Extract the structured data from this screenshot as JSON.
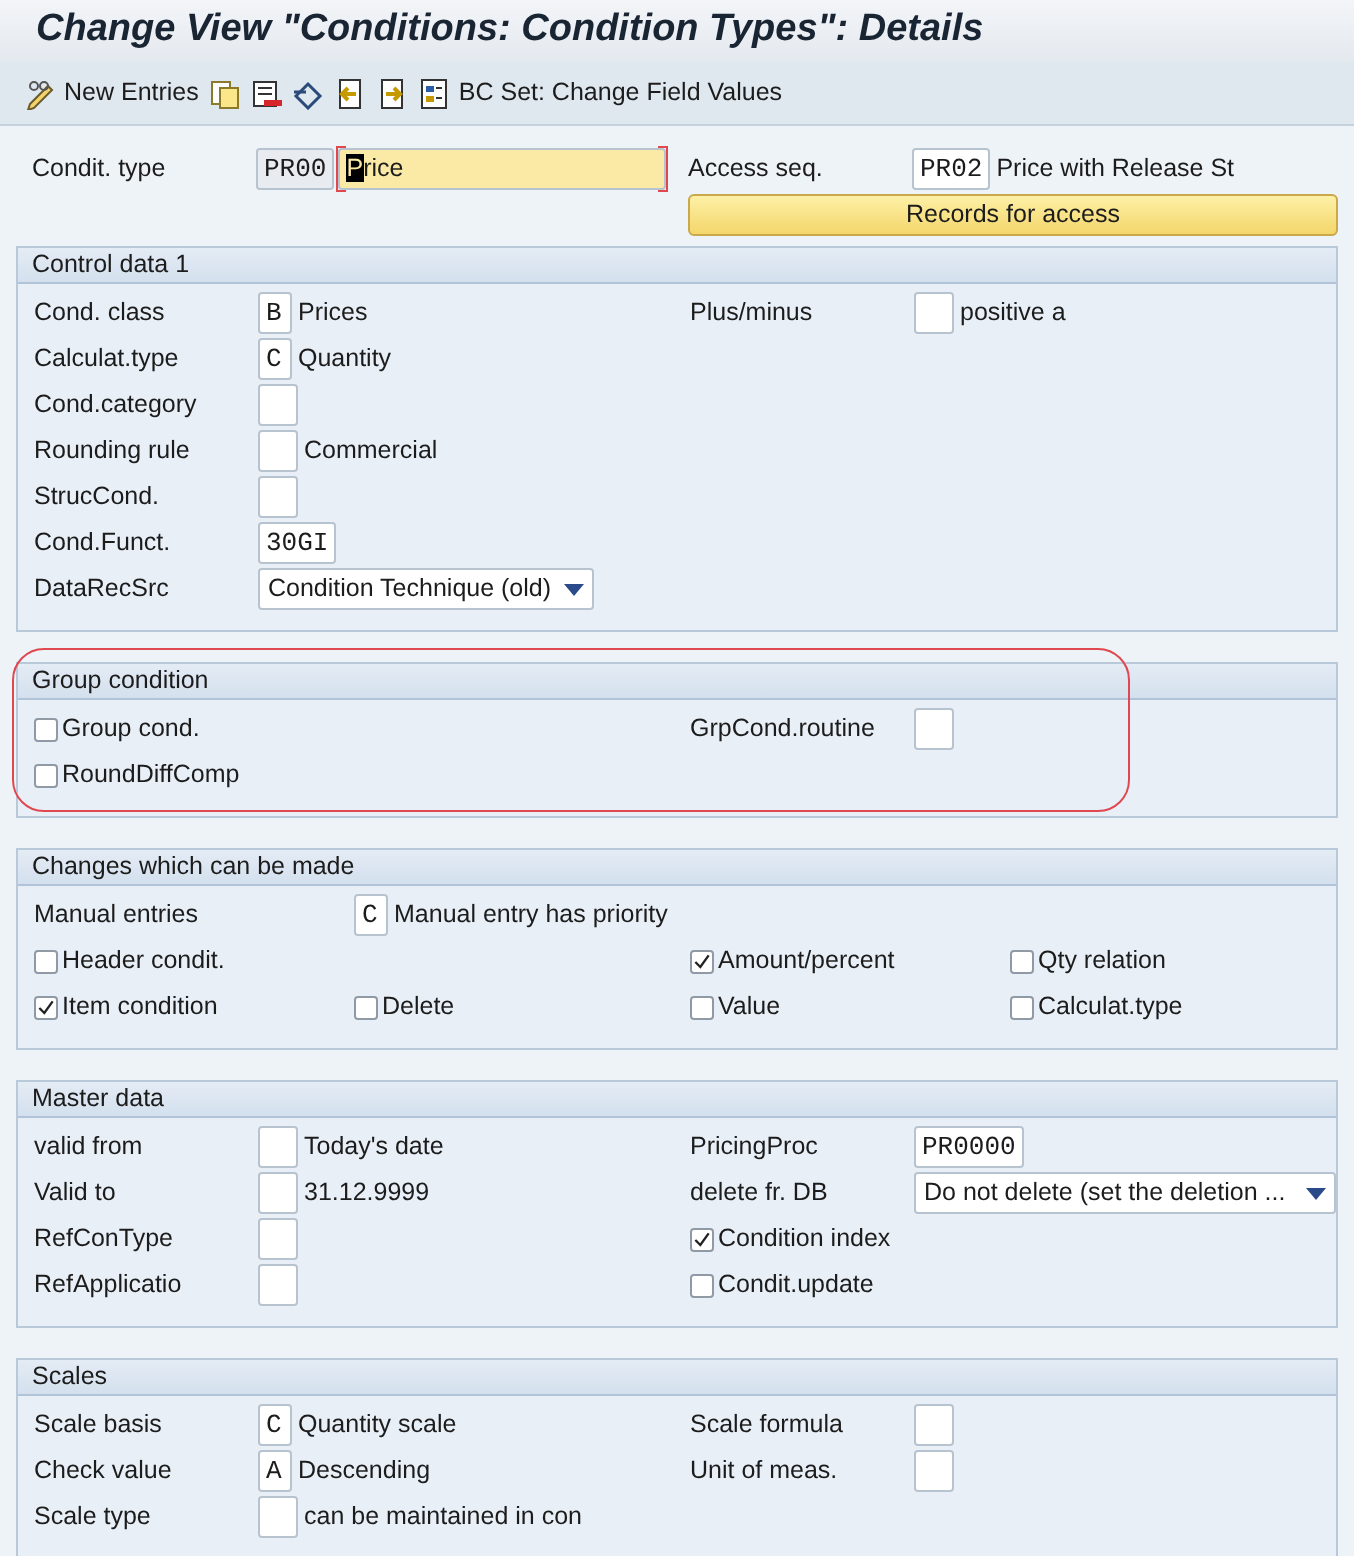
{
  "window": {
    "title": "Change View \"Conditions: Condition Types\": Details"
  },
  "toolbar": [
    "New Entries",
    "BC Set: Change Field Values"
  ],
  "header": {
    "rows": [
      {
        "left": [
          {
            "kind": "label",
            "text": "Condit. type"
          },
          {
            "kind": "field",
            "value": "PR00",
            "readonly": true
          },
          {
            "kind": "field",
            "value": "Price",
            "focused": true
          }
        ],
        "right": [
          {
            "kind": "label",
            "text": "Access seq."
          },
          {
            "kind": "field",
            "value": "PR02"
          },
          {
            "kind": "text",
            "text": "Price with Release St"
          }
        ]
      },
      {
        "left": [],
        "right": [
          {
            "kind": "button",
            "text": "Records for access"
          }
        ]
      }
    ]
  },
  "sections": [
    {
      "title": "Control data 1",
      "highlighted": false,
      "rows": [
        {
          "left": [
            {
              "kind": "label",
              "text": "Cond. class"
            },
            {
              "kind": "field",
              "value": "B"
            },
            {
              "kind": "text",
              "text": "Prices"
            }
          ],
          "right": [
            {
              "kind": "label",
              "text": "Plus/minus"
            },
            {
              "kind": "field"
            },
            {
              "kind": "text",
              "text": "positive a"
            }
          ]
        },
        {
          "left": [
            {
              "kind": "label",
              "text": "Calculat.type"
            },
            {
              "kind": "field",
              "value": "C"
            },
            {
              "kind": "text",
              "text": "Quantity"
            }
          ],
          "right": []
        },
        {
          "left": [
            {
              "kind": "label",
              "text": "Cond.category"
            },
            {
              "kind": "field"
            }
          ],
          "right": []
        },
        {
          "left": [
            {
              "kind": "label",
              "text": "Rounding rule"
            },
            {
              "kind": "field"
            },
            {
              "kind": "text",
              "text": "Commercial"
            }
          ],
          "right": []
        },
        {
          "left": [
            {
              "kind": "label",
              "text": "StrucCond."
            },
            {
              "kind": "field"
            }
          ],
          "right": []
        },
        {
          "left": [
            {
              "kind": "label",
              "text": "Cond.Funct."
            },
            {
              "kind": "field",
              "value": "30GI"
            }
          ],
          "right": []
        },
        {
          "left": [
            {
              "kind": "label",
              "text": "DataRecSrc"
            },
            {
              "kind": "select",
              "value": "Condition Technique (old)"
            }
          ],
          "right": []
        }
      ]
    },
    {
      "title": "Group condition",
      "highlighted": true,
      "rows": [
        {
          "left": [
            {
              "kind": "check",
              "label": "Group cond.",
              "checked": false
            }
          ],
          "right": [
            {
              "kind": "label",
              "text": "GrpCond.routine"
            },
            {
              "kind": "field"
            }
          ]
        },
        {
          "left": [
            {
              "kind": "check",
              "label": "RoundDiffComp",
              "checked": false
            }
          ],
          "right": []
        }
      ]
    },
    {
      "title": "Changes which can be made",
      "highlighted": false,
      "rows": [
        {
          "left": [
            {
              "kind": "label",
              "text": "Manual entries"
            },
            {
              "kind": "spacer"
            },
            {
              "kind": "field",
              "value": "C"
            },
            {
              "kind": "text",
              "text": "Manual entry has priority"
            }
          ],
          "right": []
        },
        {
          "left": [
            {
              "kind": "check",
              "label": "Header condit.",
              "checked": false
            }
          ],
          "right": [
            {
              "kind": "check",
              "label": "Amount/percent",
              "checked": true
            },
            {
              "kind": "check",
              "label": "Qty relation",
              "checked": false
            }
          ]
        },
        {
          "left": [
            {
              "kind": "check",
              "label": "Item condition",
              "checked": true
            },
            {
              "kind": "check",
              "label": "Delete",
              "checked": false
            }
          ],
          "right": [
            {
              "kind": "check",
              "label": "Value",
              "checked": false
            },
            {
              "kind": "check",
              "label": "Calculat.type",
              "checked": false
            }
          ]
        }
      ]
    },
    {
      "title": "Master data",
      "highlighted": false,
      "rows": [
        {
          "left": [
            {
              "kind": "label",
              "text": "valid from"
            },
            {
              "kind": "field"
            },
            {
              "kind": "text",
              "text": "Today's date"
            }
          ],
          "right": [
            {
              "kind": "label",
              "text": "PricingProc"
            },
            {
              "kind": "field",
              "value": "PR0000"
            }
          ]
        },
        {
          "left": [
            {
              "kind": "label",
              "text": "Valid to"
            },
            {
              "kind": "field"
            },
            {
              "kind": "text",
              "text": "31.12.9999"
            }
          ],
          "right": [
            {
              "kind": "label",
              "text": "delete fr. DB"
            },
            {
              "kind": "select",
              "value": "Do not delete (set the deletion ..."
            }
          ]
        },
        {
          "left": [
            {
              "kind": "label",
              "text": "RefConType"
            },
            {
              "kind": "field"
            }
          ],
          "right": [
            {
              "kind": "check",
              "label": "Condition index",
              "checked": true
            }
          ]
        },
        {
          "left": [
            {
              "kind": "label",
              "text": "RefApplicatio"
            },
            {
              "kind": "field"
            }
          ],
          "right": [
            {
              "kind": "check",
              "label": "Condit.update",
              "checked": false
            }
          ]
        }
      ]
    },
    {
      "title": "Scales",
      "highlighted": false,
      "rows": [
        {
          "left": [
            {
              "kind": "label",
              "text": "Scale basis"
            },
            {
              "kind": "field",
              "value": "C"
            },
            {
              "kind": "text",
              "text": "Quantity scale"
            }
          ],
          "right": [
            {
              "kind": "label",
              "text": "Scale formula"
            },
            {
              "kind": "field"
            }
          ]
        },
        {
          "left": [
            {
              "kind": "label",
              "text": "Check value"
            },
            {
              "kind": "field",
              "value": "A"
            },
            {
              "kind": "text",
              "text": "Descending"
            }
          ],
          "right": [
            {
              "kind": "label",
              "text": "Unit of meas."
            },
            {
              "kind": "field"
            }
          ]
        },
        {
          "left": [
            {
              "kind": "label",
              "text": "Scale type"
            },
            {
              "kind": "field"
            },
            {
              "kind": "text",
              "text": "can be maintained in con"
            }
          ],
          "right": []
        }
      ]
    }
  ]
}
